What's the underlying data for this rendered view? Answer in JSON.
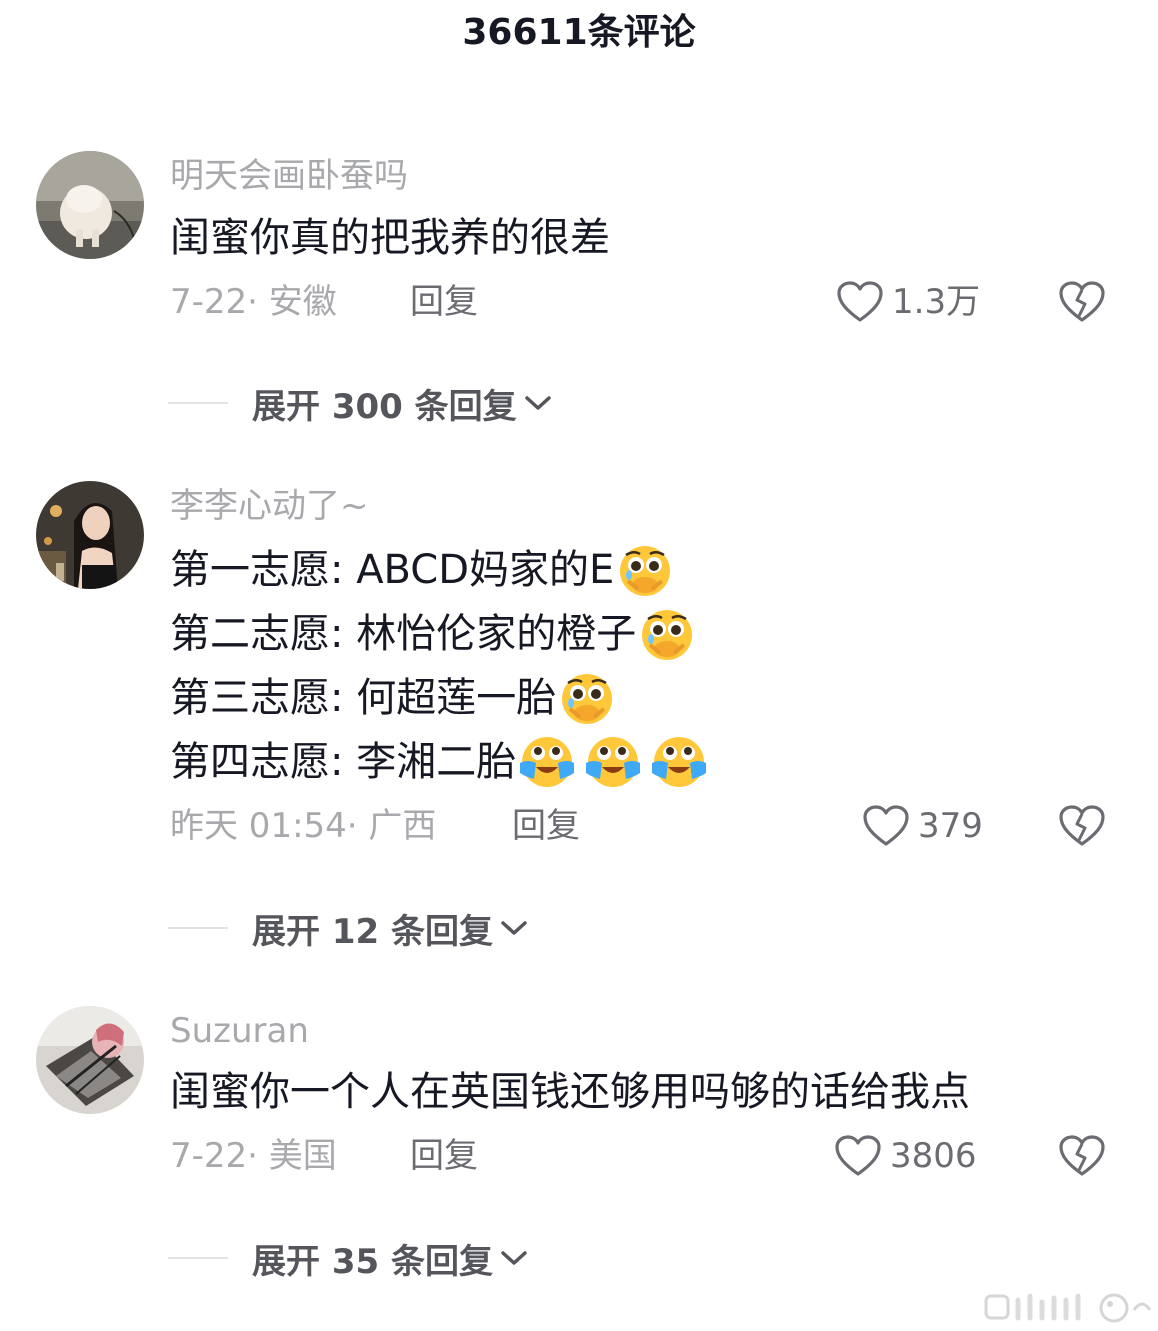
{
  "header": {
    "title": "36611条评论"
  },
  "comments": [
    {
      "username": "明天会画卧蚕吗",
      "lines": [
        "闺蜜你真的把我养的很差"
      ],
      "date_location": "7-22· 安徽",
      "reply_label": "回复",
      "likes": "1.3万",
      "expand_label": "展开 300 条回复"
    },
    {
      "username": "李李心动了~",
      "lines": [
        "第一志愿: ABCD妈家的E",
        "第二志愿: 林怡伦家的橙子",
        "第三志愿: 何超莲一胎",
        "第四志愿: 李湘二胎"
      ],
      "date_location": "昨天 01:54· 广西",
      "reply_label": "回复",
      "likes": "379",
      "expand_label": "展开 12 条回复"
    },
    {
      "username": "Suzuran",
      "lines": [
        "闺蜜你一个人在英国钱还够用吗够的话给我点"
      ],
      "date_location": "7-22· 美国",
      "reply_label": "回复",
      "likes": "3806",
      "expand_label": "展开 35 条回复"
    }
  ],
  "colors": {
    "text": "#161823",
    "muted": "#a8a9ad",
    "secondary": "#6b6c72",
    "emoji_yellow": "#ffc83a"
  },
  "icons": {
    "like": "heart-outline-icon",
    "dislike": "broken-heart-icon",
    "expand": "chevron-down-icon",
    "emoji_pleading": "pleading-face-emoji",
    "emoji_crying": "loudly-crying-face-emoji"
  }
}
